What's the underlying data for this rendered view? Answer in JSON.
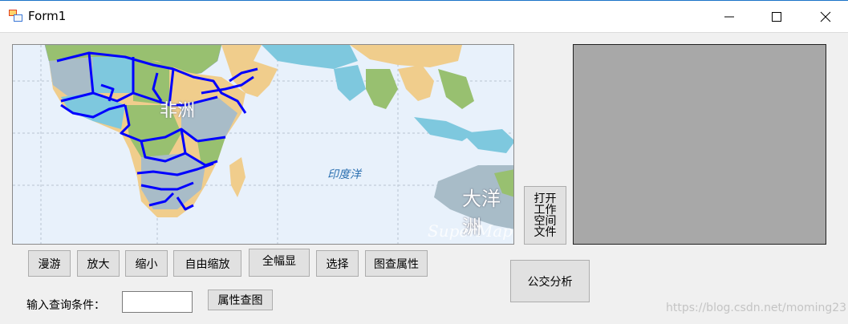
{
  "window": {
    "title": "Form1",
    "icon": "app-icon"
  },
  "map": {
    "labels": {
      "continent": "非洲",
      "ocean": "印度洋",
      "oceania": "大洋洲",
      "brand": "SuperMap"
    },
    "colors": {
      "sea": "#e8f1fb",
      "land_yellow": "#f0cd8c",
      "land_green": "#98c070",
      "land_blue": "#7ec8de",
      "land_gray": "#a8bcc8",
      "highlight": "#0000ff"
    }
  },
  "buttons": {
    "pan": "漫游",
    "zoom_in": "放大",
    "zoom_out": "缩小",
    "free_zoom": "自由缩放",
    "full_extent": "全幅显",
    "select": "选择",
    "identify_attr": "图查属性",
    "open_workspace": "打开工作空间文件",
    "bus_analysis": "公交分析",
    "attr_query": "属性查图"
  },
  "query": {
    "label": "输入查询条件：",
    "value": ""
  },
  "overlay": {
    "watermark": "https://blog.csdn.net/moming23"
  }
}
